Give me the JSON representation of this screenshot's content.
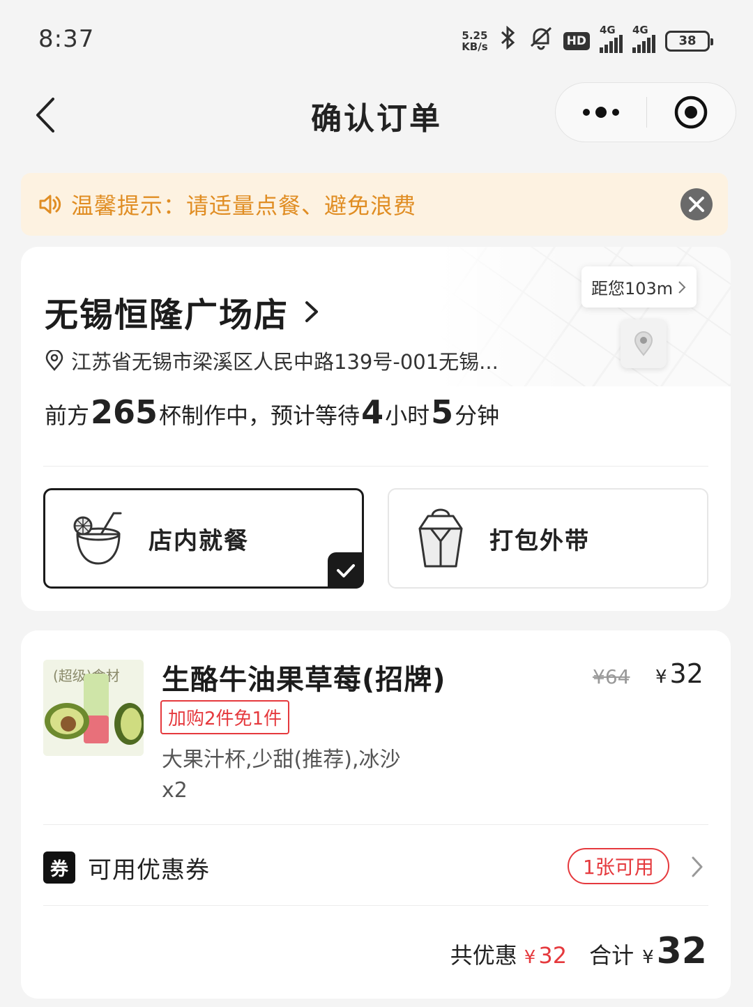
{
  "status_bar": {
    "time": "8:37",
    "net_speed_value": "5.25",
    "net_speed_unit": "KB/s",
    "hd_label": "HD",
    "signal1_label": "4G",
    "signal2_label": "4G",
    "battery": "38"
  },
  "nav": {
    "title": "确认订单"
  },
  "notice": {
    "text": "温馨提示：请适量点餐、避免浪费"
  },
  "store": {
    "name": "无锡恒隆广场店",
    "address": "江苏省无锡市梁溪区人民中路139号-001无锡...",
    "distance": "距您103m",
    "queue": {
      "prefix": "前方",
      "cups": "265",
      "middle": "杯制作中，预计等待",
      "hours": "4",
      "hours_unit": "小时",
      "minutes": "5",
      "minutes_unit": "分钟"
    },
    "modes": [
      {
        "label": "店内就餐",
        "selected": true
      },
      {
        "label": "打包外带",
        "selected": false
      }
    ]
  },
  "order": {
    "item": {
      "image_caption": "(超级)食材",
      "name": "生酪牛油果草莓(招牌)",
      "promo_tag": "加购2件免1件",
      "specs": "大果汁杯,少甜(推荐),冰沙",
      "quantity": "x2",
      "original_price": "¥64",
      "currency": "¥",
      "price": "32"
    },
    "coupon": {
      "badge": "券",
      "label": "可用优惠券",
      "available": "1张可用"
    },
    "summary": {
      "discount_label": "共优惠",
      "discount_currency": "¥",
      "discount_amount": "32",
      "total_label": "合计",
      "total_currency": "¥",
      "total_amount": "32"
    }
  },
  "colors": {
    "accent_red": "#e5393d",
    "notice_orange": "#e08d23",
    "notice_bg": "#fdf2e1"
  }
}
